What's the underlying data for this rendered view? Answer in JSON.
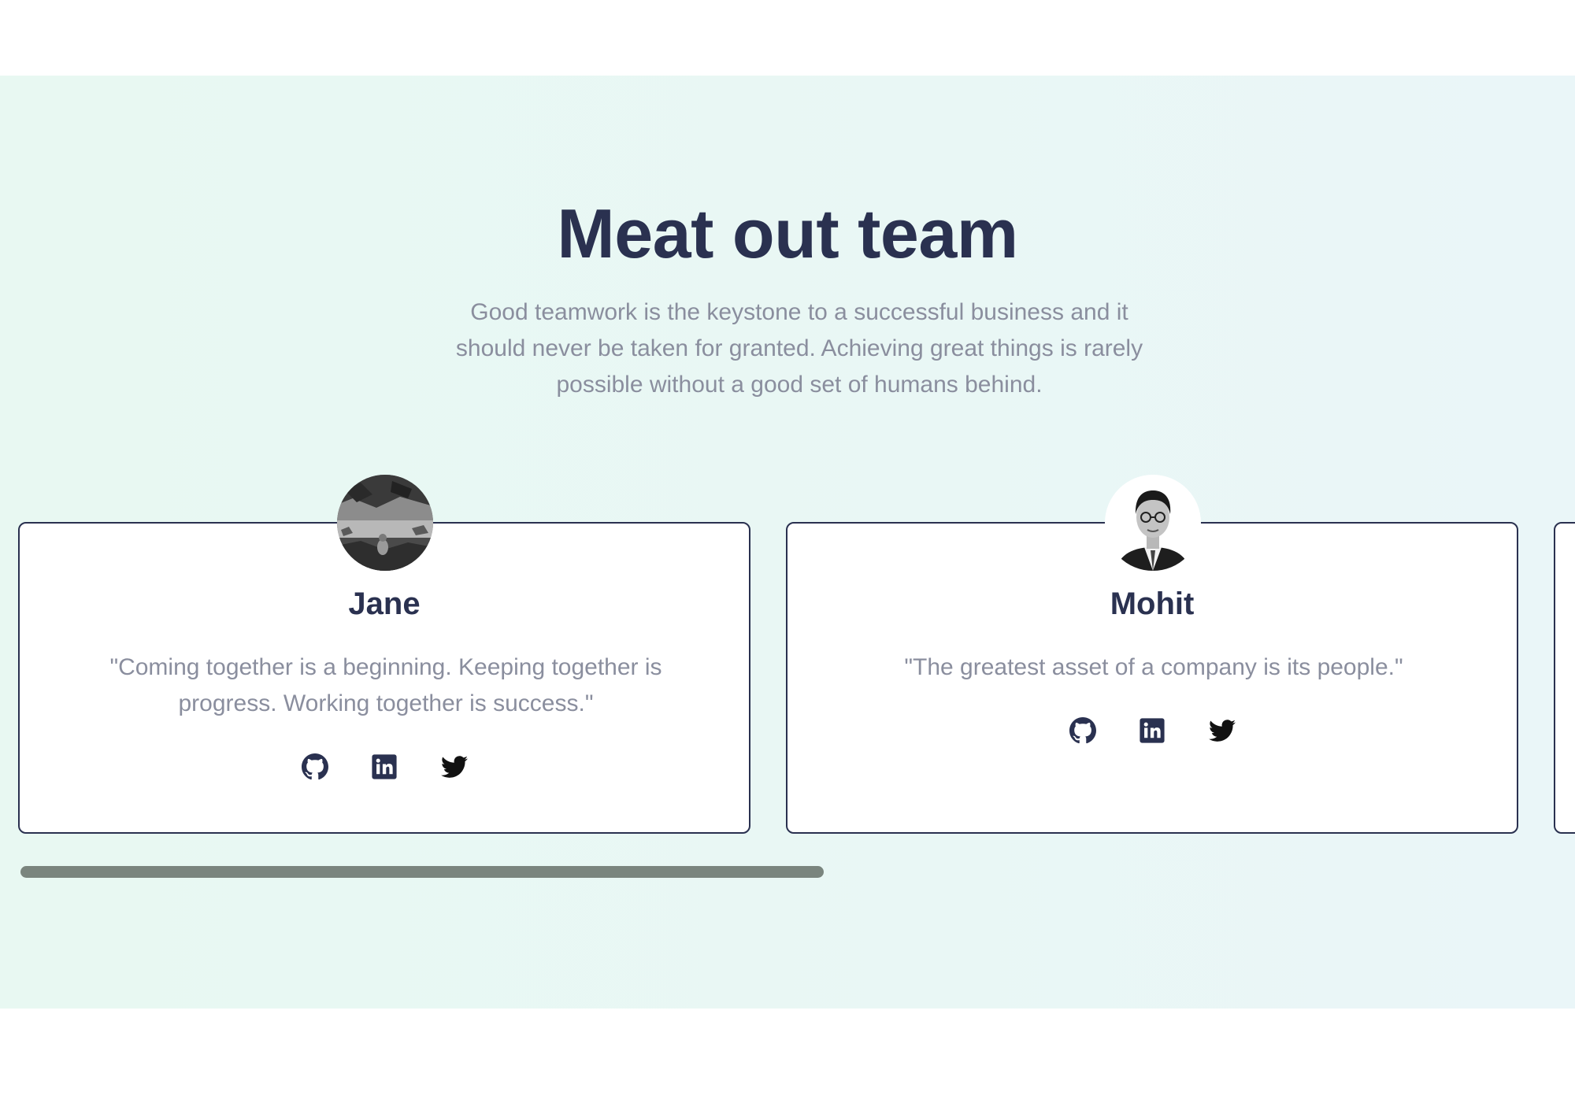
{
  "team": {
    "title": "Meat out team",
    "subtitle": "Good teamwork is the keystone to a successful business and it should never be taken for granted. Achieving great things is rarely possible without a good set of humans behind.",
    "members": [
      {
        "name": "Jane",
        "quote": "\"Coming together is a beginning. Keeping together is progress. Working together is success.\"",
        "avatar_icon": "landscape-photo",
        "social_icons": [
          "github-icon",
          "linkedin-icon",
          "twitter-icon"
        ]
      },
      {
        "name": "Mohit",
        "quote": "\"The greatest asset of a company is its people.\"",
        "avatar_icon": "portrait-photo",
        "social_icons": [
          "github-icon",
          "linkedin-icon",
          "twitter-icon"
        ]
      }
    ]
  },
  "colors": {
    "heading": "#2a3150",
    "body_text": "#8a8e9e",
    "section_bg": "#e9f7f4",
    "scrollbar": "#7a857e",
    "twitter_icon": "#111111"
  }
}
